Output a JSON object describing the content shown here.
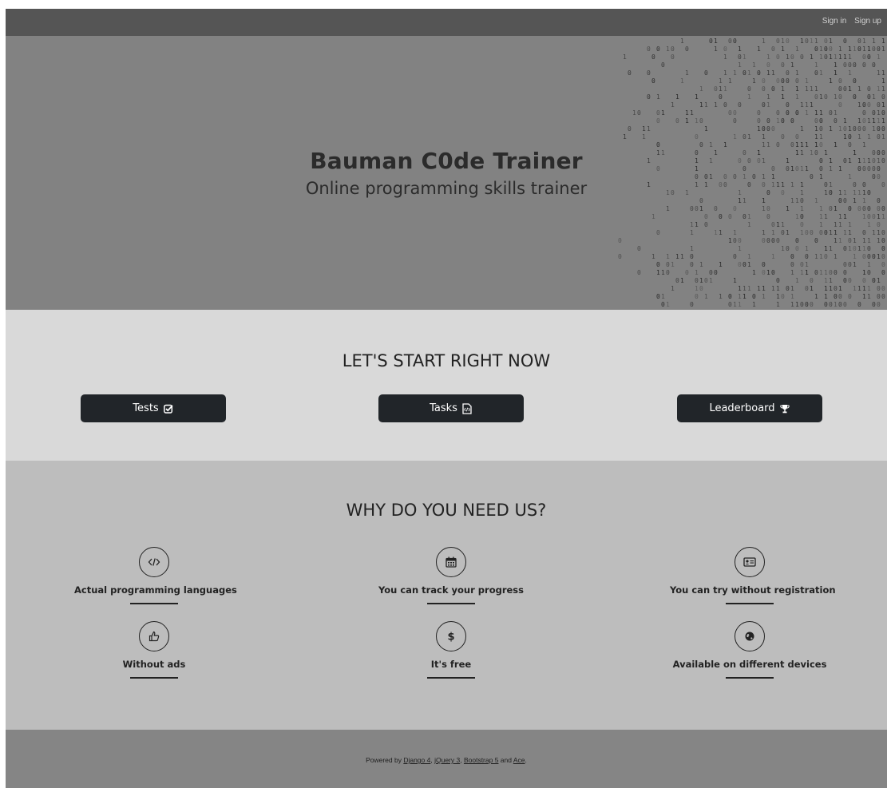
{
  "nav": {
    "signin": "Sign in",
    "signup": "Sign up"
  },
  "hero": {
    "title": "Bauman C0de Trainer",
    "subtitle": "Online programming skills trainer"
  },
  "start": {
    "title": "LET'S START RIGHT NOW",
    "buttons": [
      {
        "label": "Tests",
        "icon": "check-square-icon"
      },
      {
        "label": "Tasks",
        "icon": "code-file-icon"
      },
      {
        "label": "Leaderboard",
        "icon": "trophy-icon"
      }
    ]
  },
  "why": {
    "title": "WHY DO YOU NEED US?",
    "features": [
      {
        "label": "Actual programming languages",
        "icon": "code-icon"
      },
      {
        "label": "You can track your progress",
        "icon": "calendar-icon"
      },
      {
        "label": "You can try without registration",
        "icon": "id-card-icon"
      },
      {
        "label": "Without ads",
        "icon": "thumbs-up-icon"
      },
      {
        "label": "It's free",
        "icon": "dollar-icon"
      },
      {
        "label": "Available on different devices",
        "icon": "globe-icon"
      }
    ]
  },
  "footer": {
    "prefix": "Powered by ",
    "links": [
      "Django 4",
      "jQuery 3",
      "Bootstrap 5",
      "Ace"
    ],
    "sep1": ", ",
    "sep2": ", ",
    "sep3": " and ",
    "suffix": "."
  },
  "colors": {
    "navbar": "#555555",
    "hero": "#828282",
    "start_bg": "#d9d9d9",
    "why_bg": "#bdbdbd",
    "footer_bg": "#858585",
    "button": "#212529"
  }
}
